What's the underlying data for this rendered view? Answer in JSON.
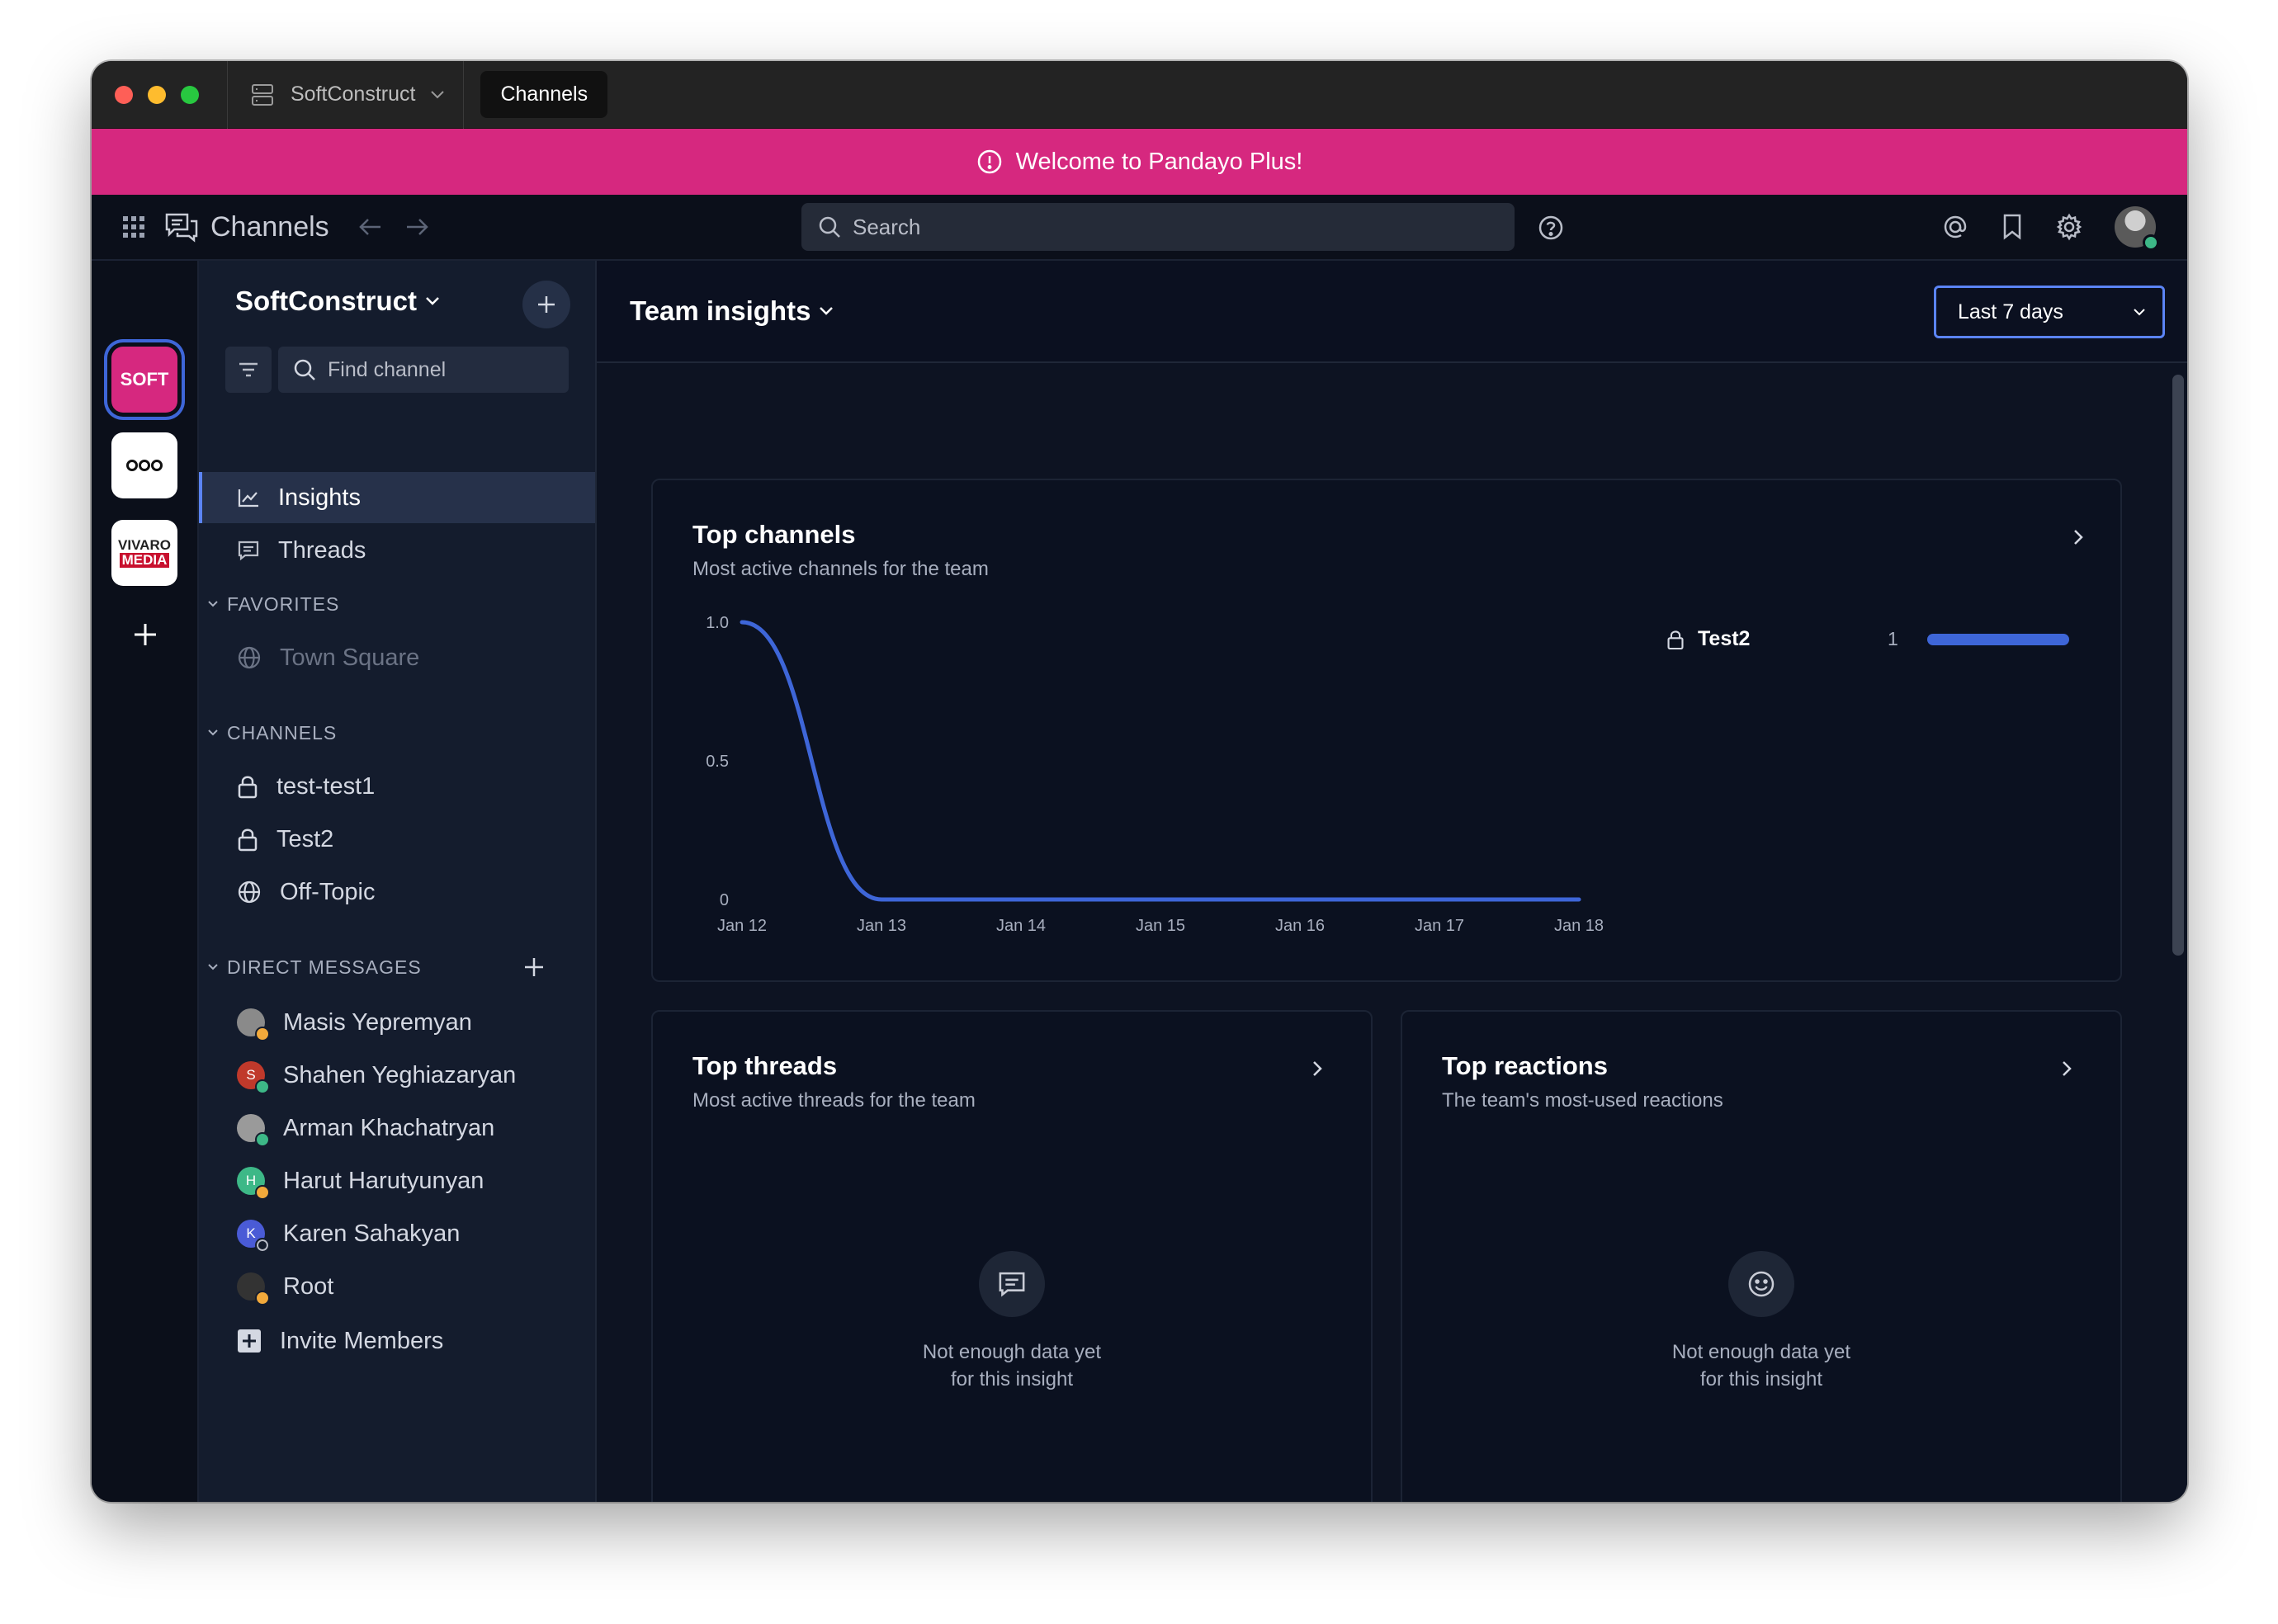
{
  "titlebar": {
    "server_name": "SoftConstruct",
    "tab_label": "Channels"
  },
  "banner": {
    "text": "Welcome to Pandayo Plus!",
    "color": "#d6287f"
  },
  "topnav": {
    "app_title": "Channels",
    "search_placeholder": "Search"
  },
  "teams": [
    {
      "name": "SoftConstruct",
      "label": "SOFT",
      "color": "#d6287f"
    },
    {
      "name": "ooo",
      "label": ""
    },
    {
      "name": "Vivaro Media",
      "label_top": "VIVARO",
      "label_bottom": "MEDIA"
    }
  ],
  "sidebar": {
    "team_name": "SoftConstruct",
    "find_placeholder": "Find channel",
    "insights_label": "Insights",
    "threads_label": "Threads",
    "favorites_header": "FAVORITES",
    "favorites": [
      "Town Square"
    ],
    "channels_header": "CHANNELS",
    "channels": [
      {
        "name": "test-test1",
        "type": "private"
      },
      {
        "name": "Test2",
        "type": "private"
      },
      {
        "name": "Off-Topic",
        "type": "public"
      }
    ],
    "dm_header": "DIRECT MESSAGES",
    "dms": [
      {
        "name": "Masis Yepremyan",
        "initial": "",
        "avatar_color": "#8a8a8a",
        "status": "away"
      },
      {
        "name": "Shahen Yeghiazaryan",
        "initial": "S",
        "avatar_color": "#c0392b",
        "status": "online"
      },
      {
        "name": "Arman Khachatryan",
        "initial": "",
        "avatar_color": "#9a9a9a",
        "status": "online"
      },
      {
        "name": "Harut Harutyunyan",
        "initial": "H",
        "avatar_color": "#3db887",
        "status": "away"
      },
      {
        "name": "Karen Sahakyan",
        "initial": "K",
        "avatar_color": "#4a5bd6",
        "status": "offline"
      },
      {
        "name": "Root",
        "initial": "",
        "avatar_color": "#333333",
        "status": "away"
      }
    ],
    "invite_label": "Invite Members"
  },
  "main": {
    "title": "Team insights",
    "date_range": "Last 7 days",
    "top_channels": {
      "title": "Top channels",
      "subtitle": "Most active channels for the team",
      "legend": [
        {
          "name": "Test2",
          "value": "1",
          "color": "#3e66d8"
        }
      ]
    },
    "top_threads": {
      "title": "Top threads",
      "subtitle": "Most active threads for the team",
      "empty_line1": "Not enough data yet",
      "empty_line2": "for this insight"
    },
    "top_reactions": {
      "title": "Top reactions",
      "subtitle": "The team's most-used reactions",
      "empty_line1": "Not enough data yet",
      "empty_line2": "for this insight"
    }
  },
  "chart_data": {
    "type": "line",
    "title": "",
    "x": [
      "Jan 12",
      "Jan 13",
      "Jan 14",
      "Jan 15",
      "Jan 16",
      "Jan 17",
      "Jan 18"
    ],
    "series": [
      {
        "name": "Test2",
        "values": [
          1,
          0,
          0,
          0,
          0,
          0,
          0
        ],
        "color": "#3e66d8"
      }
    ],
    "yticks": [
      "0",
      "0.5",
      "1.0"
    ],
    "ylim": [
      0,
      1
    ],
    "grid": false,
    "legend": "right"
  }
}
